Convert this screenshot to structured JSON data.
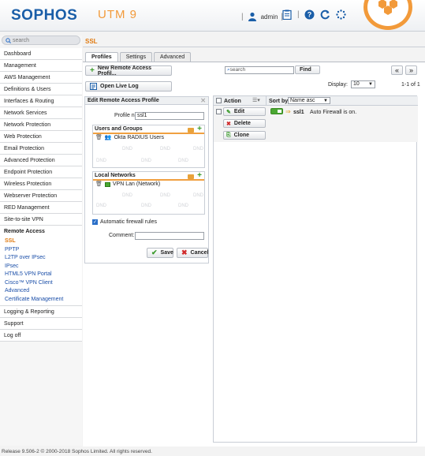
{
  "header": {
    "logo": "SOPHOS",
    "product": "UTM 9",
    "user": "admin"
  },
  "sidebar": {
    "search_placeholder": "search",
    "items": [
      {
        "label": "Dashboard"
      },
      {
        "label": "Management"
      },
      {
        "label": "AWS Management"
      },
      {
        "label": "Definitions & Users"
      },
      {
        "label": "Interfaces & Routing"
      },
      {
        "label": "Network Services"
      },
      {
        "label": "Network Protection"
      },
      {
        "label": "Web Protection"
      },
      {
        "label": "Email Protection"
      },
      {
        "label": "Advanced Protection"
      },
      {
        "label": "Endpoint Protection"
      },
      {
        "label": "Wireless Protection"
      },
      {
        "label": "Webserver Protection"
      },
      {
        "label": "RED Management"
      },
      {
        "label": "Site-to-site VPN"
      },
      {
        "label": "Remote Access"
      }
    ],
    "sub_items": [
      {
        "label": "SSL"
      },
      {
        "label": "PPTP"
      },
      {
        "label": "L2TP over IPsec"
      },
      {
        "label": "IPsec"
      },
      {
        "label": "HTML5 VPN Portal"
      },
      {
        "label": "Cisco™ VPN Client"
      },
      {
        "label": "Advanced"
      },
      {
        "label": "Certificate Management"
      }
    ],
    "bottom_items": [
      {
        "label": "Logging & Reporting"
      },
      {
        "label": "Support"
      },
      {
        "label": "Log off"
      }
    ]
  },
  "main": {
    "page_title": "SSL",
    "tabs": [
      {
        "label": "Profiles"
      },
      {
        "label": "Settings"
      },
      {
        "label": "Advanced"
      }
    ],
    "new_profile_button": "New Remote Access Profil...",
    "open_live_log_button": "Open Live Log",
    "search_placeholder": "search",
    "find_button": "Find",
    "nav_prev": "«",
    "nav_next": "»",
    "display_label": "Display:",
    "display_value": "10",
    "pager": "1-1 of 1"
  },
  "edit_panel": {
    "title": "Edit Remote Access Profile",
    "profile_name_label": "Profile name:",
    "profile_name_value": "ssl1",
    "users_groups_title": "Users and Groups",
    "users_groups_item": "Okta RADIUS Users",
    "local_networks_title": "Local Networks",
    "local_networks_item": "VPN Lan (Network)",
    "dnd": "DND",
    "auto_firewall_label": "Automatic firewall rules",
    "comment_label": "Comment:",
    "comment_value": "",
    "save_button": "Save",
    "cancel_button": "Cancel"
  },
  "list": {
    "action_header": "Action",
    "sort_by_label": "Sort by:",
    "sort_value": "Name asc",
    "row": {
      "edit_button": "Edit",
      "delete_button": "Delete",
      "clone_button": "Clone",
      "name": "ssl1",
      "description": "Auto Firewall is on."
    }
  },
  "footer": {
    "text": "Release 9.506-2  © 2000-2018 Sophos Limited. All rights reserved."
  },
  "colors": {
    "brand_blue": "#1a5ea8",
    "accent_orange": "#f29a3a",
    "active_green": "#4aa832"
  }
}
